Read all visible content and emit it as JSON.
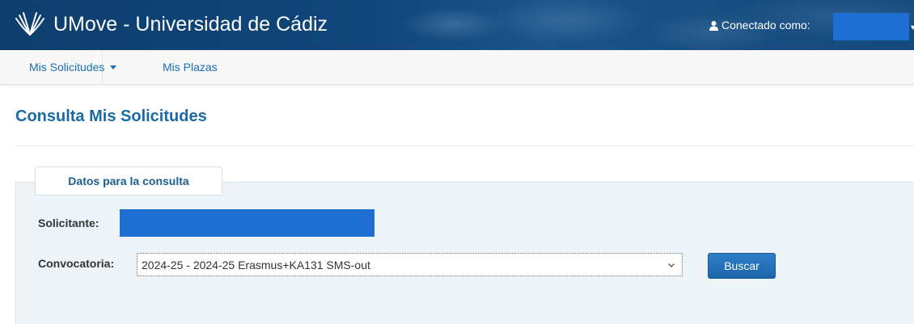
{
  "header": {
    "app_title": "UMove - Universidad de Cádiz",
    "logo_icon": "uca-logo-icon",
    "user_label": "Conectado como:",
    "user_icon": "user-icon",
    "user_name_redacted": ""
  },
  "nav": {
    "items": [
      {
        "label": "Mis Solicitudes",
        "has_dropdown": true
      },
      {
        "label": "Mis Plazas",
        "has_dropdown": false
      }
    ]
  },
  "main": {
    "page_title": "Consulta Mis Solicitudes",
    "panel_legend": "Datos para la consulta",
    "fields": {
      "solicitante_label": "Solicitante:",
      "solicitante_value_redacted": "",
      "convocatoria_label": "Convocatoria:",
      "convocatoria_selected": "2024-25 - 2024-25 Erasmus+KA131 SMS-out"
    },
    "search_button_label": "Buscar"
  },
  "colors": {
    "header_bg": "#11467a",
    "link": "#1a6fb0",
    "title": "#1a6aa6",
    "panel_bg": "#eef3f7",
    "button": "#1b64a9",
    "redaction": "#1e6fd1"
  }
}
